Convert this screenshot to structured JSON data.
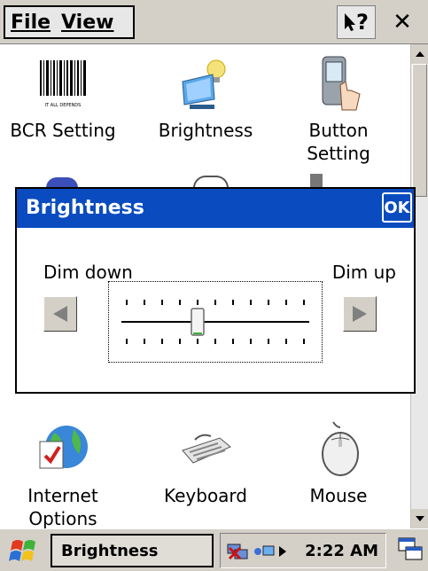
{
  "menubar": {
    "file_label": "File",
    "view_label": "View",
    "help_label": "?",
    "close_label": "✕"
  },
  "icons": [
    {
      "label": "BCR Setting",
      "icon": "barcode-icon",
      "caption": "IT ALL DEPENDS"
    },
    {
      "label": "Brightness",
      "icon": "brightness-icon"
    },
    {
      "label": "Button\nSetting",
      "icon": "button-setting-icon"
    },
    {
      "label": "Internet\nOptions",
      "icon": "internet-options-icon"
    },
    {
      "label": "Keyboard",
      "icon": "keyboard-icon"
    },
    {
      "label": "Mouse",
      "icon": "mouse-icon"
    }
  ],
  "dialog": {
    "title": "Brightness",
    "ok_label": "OK",
    "dim_down_label": "Dim down",
    "dim_up_label": "Dim up",
    "slider_level_fraction": 0.4,
    "tick_count": 11
  },
  "taskbar": {
    "task_label": "Brightness",
    "clock": "2:22 AM"
  },
  "colors": {
    "dialog_title_bg": "#0a4cbf",
    "chrome_bg": "#d4d0c8"
  }
}
